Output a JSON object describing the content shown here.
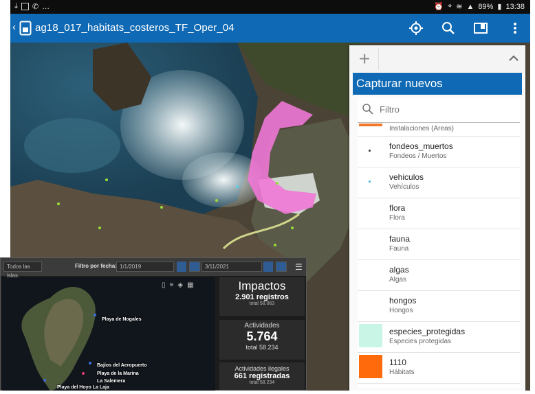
{
  "status_bar": {
    "time": "13:38",
    "battery": "89%"
  },
  "app_bar": {
    "title": "ag18_017_habitats_costeros_TF_Oper_04",
    "actions": [
      "locate-icon",
      "search-icon",
      "bookmark-icon",
      "more-icon"
    ]
  },
  "panel": {
    "header": "Capturar nuevos",
    "search_placeholder": "Filtro",
    "items": [
      {
        "name": "",
        "desc": "Instalaciones (Areas)",
        "swatch": "#f2782a"
      },
      {
        "name": "fondeos_muertos",
        "desc": "Fondeos / Muertos",
        "swatch": "#444444"
      },
      {
        "name": "vehiculos",
        "desc": "Vehículos",
        "swatch": "#3fb6d9"
      },
      {
        "name": "flora",
        "desc": "Flora",
        "swatch": ""
      },
      {
        "name": "fauna",
        "desc": "Fauna",
        "swatch": ""
      },
      {
        "name": "algas",
        "desc": "Algas",
        "swatch": ""
      },
      {
        "name": "hongos",
        "desc": "Hongos",
        "swatch": ""
      },
      {
        "name": "especies_protegidas",
        "desc": "Especies protegidas",
        "swatch": "#c8f5e6"
      },
      {
        "name": "1110",
        "desc": "Hábitats",
        "swatch": "#ff6a0d"
      }
    ]
  },
  "dashboard": {
    "tab": "Todos las islas",
    "filter_label": "Filtro por fecha:",
    "date_from": "1/1/2019",
    "date_to": "3/11/2021",
    "cards": {
      "impactos": {
        "title": "Impactos",
        "value": "2.901 registros",
        "sub": "total 58.063"
      },
      "actividades": {
        "title": "Actividades",
        "value": "5.764",
        "sub": "total 58.234"
      },
      "ilegales": {
        "title": "Actividades ilegales",
        "value": "661 registradas",
        "sub": "total 58.234"
      }
    },
    "places": [
      "Playa de Nogales",
      "Bajíos del Aeropuerto",
      "Playa de la Marina",
      "La Salemera",
      "Playa del Hoyo La Laja"
    ]
  }
}
